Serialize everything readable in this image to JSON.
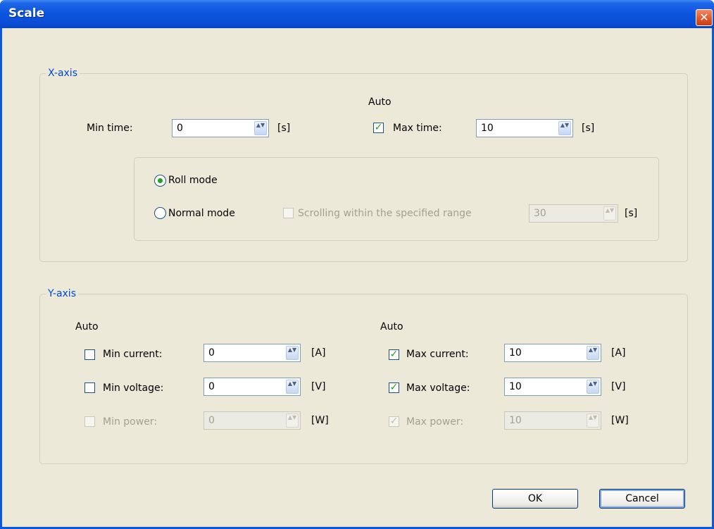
{
  "window": {
    "title": "Scale",
    "close_glyph": "✕"
  },
  "x_axis": {
    "legend": "X-axis",
    "auto_label": "Auto",
    "min_time": {
      "label": "Min time:",
      "value": "0",
      "unit": "[s]"
    },
    "max_time": {
      "label": "Max time:",
      "value": "10",
      "unit": "[s]",
      "auto_checked": true
    },
    "roll_mode": {
      "label": "Roll mode",
      "selected": true
    },
    "normal_mode": {
      "label": "Normal mode",
      "selected": false
    },
    "scrolling": {
      "label": "Scrolling within the specified range",
      "value": "30",
      "unit": "[s]",
      "enabled": false
    }
  },
  "y_axis": {
    "legend": "Y-axis",
    "auto_left": "Auto",
    "auto_right": "Auto",
    "min_current": {
      "label": "Min current:",
      "value": "0",
      "unit": "[A]",
      "checked": false
    },
    "min_voltage": {
      "label": "Min voltage:",
      "value": "0",
      "unit": "[V]",
      "checked": false
    },
    "min_power": {
      "label": "Min power:",
      "value": "0",
      "unit": "[W]",
      "checked": false,
      "enabled": false
    },
    "max_current": {
      "label": "Max current:",
      "value": "10",
      "unit": "[A]",
      "checked": true
    },
    "max_voltage": {
      "label": "Max voltage:",
      "value": "10",
      "unit": "[V]",
      "checked": true
    },
    "max_power": {
      "label": "Max power:",
      "value": "10",
      "unit": "[W]",
      "checked": true,
      "enabled": false
    }
  },
  "buttons": {
    "ok": "OK",
    "cancel": "Cancel"
  },
  "glyphs": {
    "check": "✓",
    "spin": "▲▼"
  }
}
